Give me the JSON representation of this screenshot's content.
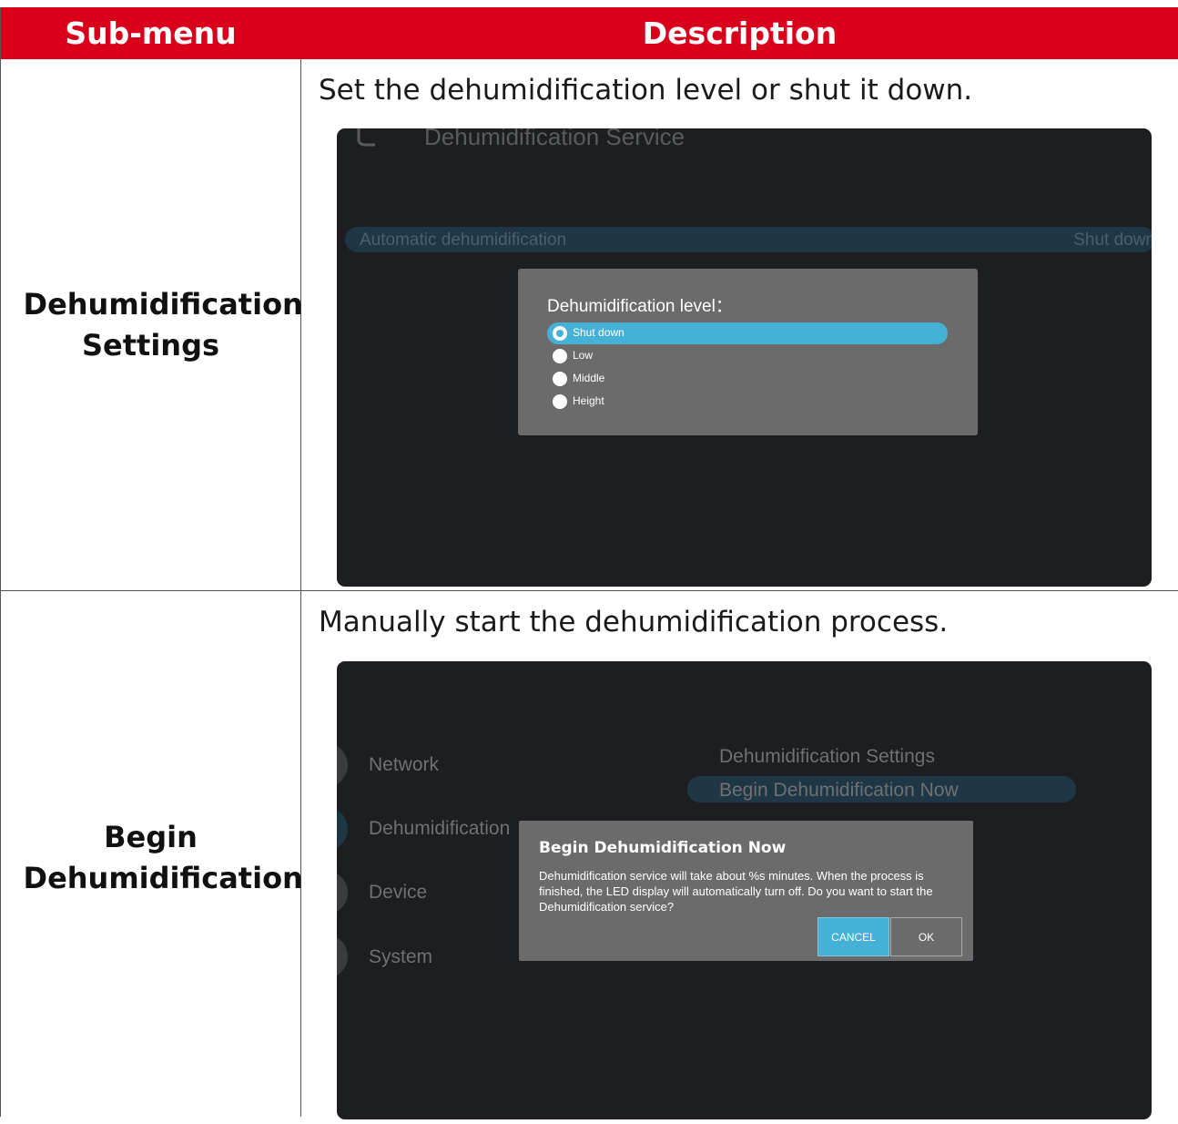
{
  "table": {
    "headers": {
      "sub_menu": "Sub-menu",
      "description": "Description"
    },
    "rows": [
      {
        "sub_menu": "Dehumidification Settings",
        "description": "Set the dehumidification level or shut it down.",
        "screen": {
          "header_title": "Dehumidification Service",
          "setting_label": "Automatic dehumidification",
          "setting_value": "Shut down",
          "dialog": {
            "title": "Dehumidification level：",
            "options": [
              "Shut down",
              "Low",
              "Middle",
              "Height"
            ],
            "selected": "Shut down"
          }
        }
      },
      {
        "sub_menu": "Begin Dehumidification",
        "description": "Manually start the dehumidification process.",
        "screen": {
          "left_menu": [
            "Network",
            "Dehumidification",
            "Device",
            "System"
          ],
          "right_menu": [
            "Dehumidification Settings",
            "Begin Dehumidification Now"
          ],
          "dialog": {
            "title": "Begin Dehumidification Now",
            "message": "Dehumidification service will take about %s minutes. When the process is finished, the LED display will automatically turn off. Do you want to start the Dehumidification service?",
            "cancel_label": "CANCEL",
            "ok_label": "OK"
          }
        }
      }
    ]
  },
  "colors": {
    "header_bg": "#d9001b",
    "screen_bg": "#1d1e21",
    "dialog_bg": "#6b6b6b",
    "accent": "#45b1d6"
  }
}
